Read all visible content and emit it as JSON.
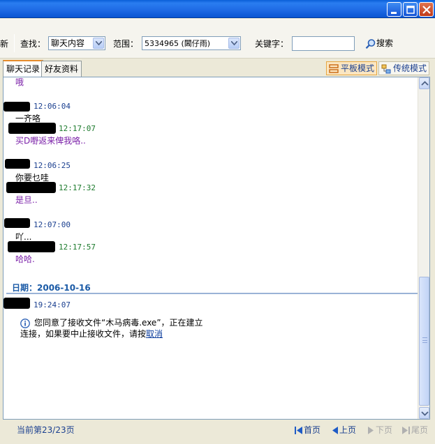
{
  "window": {
    "minimize_icon": "minimize-icon",
    "maximize_icon": "maximize-icon",
    "close_icon": "close-icon"
  },
  "toolbar": {
    "partial_label": "新",
    "find_label": "查找：",
    "find_select_value": "聊天内容",
    "scope_label": "范围：",
    "scope_select_value": "5334965 (閪仔雨)",
    "keyword_label": "关键字：",
    "keyword_value": "",
    "search_label": "搜索"
  },
  "tabs": {
    "chat_history": "聊天记录",
    "friend_info": "好友资料"
  },
  "modes": {
    "flat_mode": "平板模式",
    "classic_mode": "传统模式"
  },
  "messages": {
    "top_fragment": "哦",
    "m1_time": "12:06:04",
    "m1_text": "一齐咯",
    "m2_time": "12:17:07",
    "m2_text": "买D嘢返来俾我咯..",
    "m3_time": "12:06:25",
    "m3_text": "你要乜哇",
    "m4_time": "12:17:32",
    "m4_text": "是旦..",
    "m5_time": "12:07:00",
    "m5_text": "吖...",
    "m6_time": "12:17:57",
    "m6_text": "哈哈.",
    "date_header": "日期：2006-10-16",
    "m7_time": "19:24:07",
    "notice_text": "您同意了接收文件“木马病毒.exe”，正在建立连接，如果要中止接收文件，请按",
    "notice_link": "取消"
  },
  "footer": {
    "page_info": "当前第23/23页",
    "first": "首页",
    "prev": "上页",
    "next": "下页",
    "last": "尾页"
  },
  "colors": {
    "titlebar": "#1f6ce6",
    "time_sender": "#1a3f8f",
    "time_receiver": "#1c7a2c",
    "msg_receiver": "#7a1fa8",
    "date_header": "#1a5aa6"
  }
}
